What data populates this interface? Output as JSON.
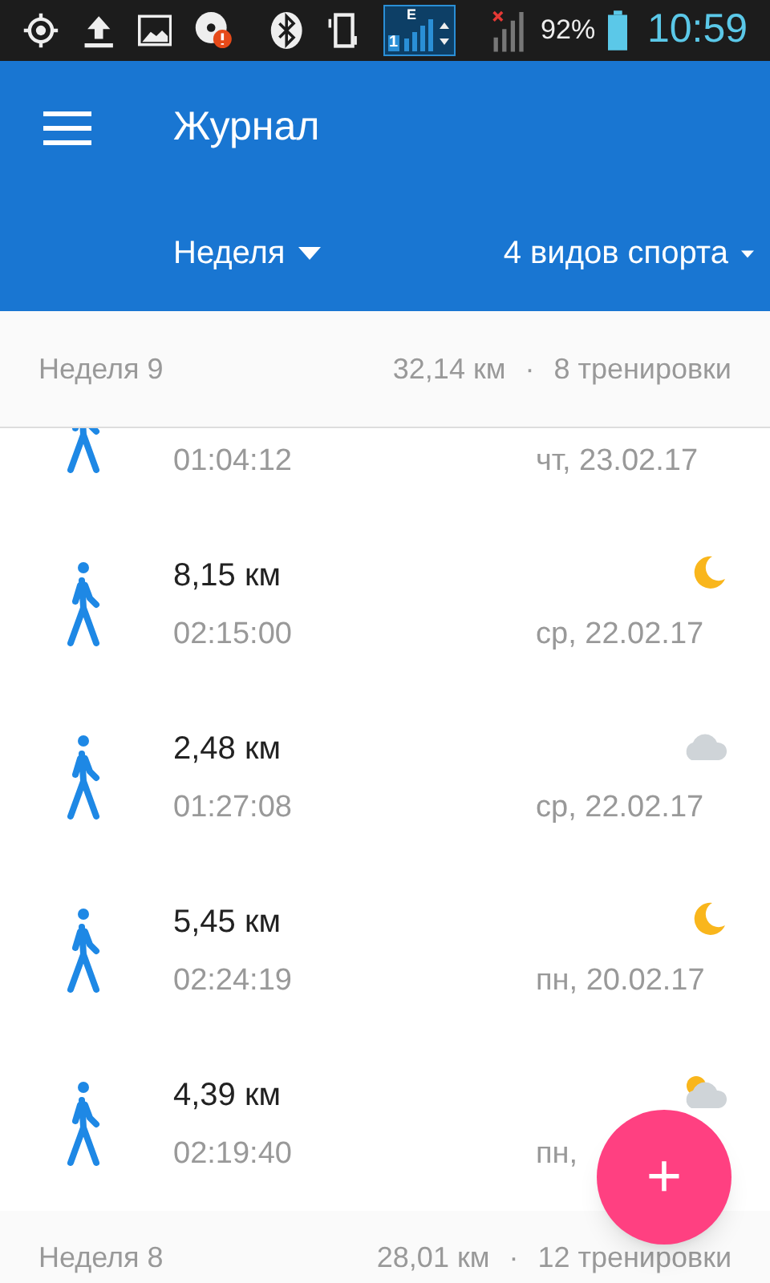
{
  "status_bar": {
    "network_type": "E",
    "sim": "1",
    "battery": "92%",
    "time": "10:59"
  },
  "app_bar": {
    "title": "Журнал",
    "filters": [
      {
        "label": "Неделя"
      },
      {
        "label": "4 видов спорта"
      }
    ]
  },
  "weeks": [
    {
      "title": "Неделя 9",
      "distance": "32,14 км",
      "separator": "·",
      "workouts": "8 тренировки",
      "items": [
        {
          "kind": "none",
          "duration": "01:04:12",
          "date": "чт, 23.02.17"
        },
        {
          "kind": "moon",
          "distance": "8,15 км",
          "duration": "02:15:00",
          "date": "ср, 22.02.17"
        },
        {
          "kind": "cloudy",
          "distance": "2,48 км",
          "duration": "01:27:08",
          "date": "ср, 22.02.17"
        },
        {
          "kind": "moon",
          "distance": "5,45 км",
          "duration": "02:24:19",
          "date": "пн, 20.02.17"
        },
        {
          "kind": "partly_cloudy",
          "distance": "4,39 км",
          "duration": "02:19:40",
          "date": "пн,"
        }
      ]
    },
    {
      "title": "Неделя 8",
      "distance": "28,01 км",
      "separator": "·",
      "workouts": "12 тренировки"
    }
  ],
  "fab": {
    "label": "+"
  }
}
